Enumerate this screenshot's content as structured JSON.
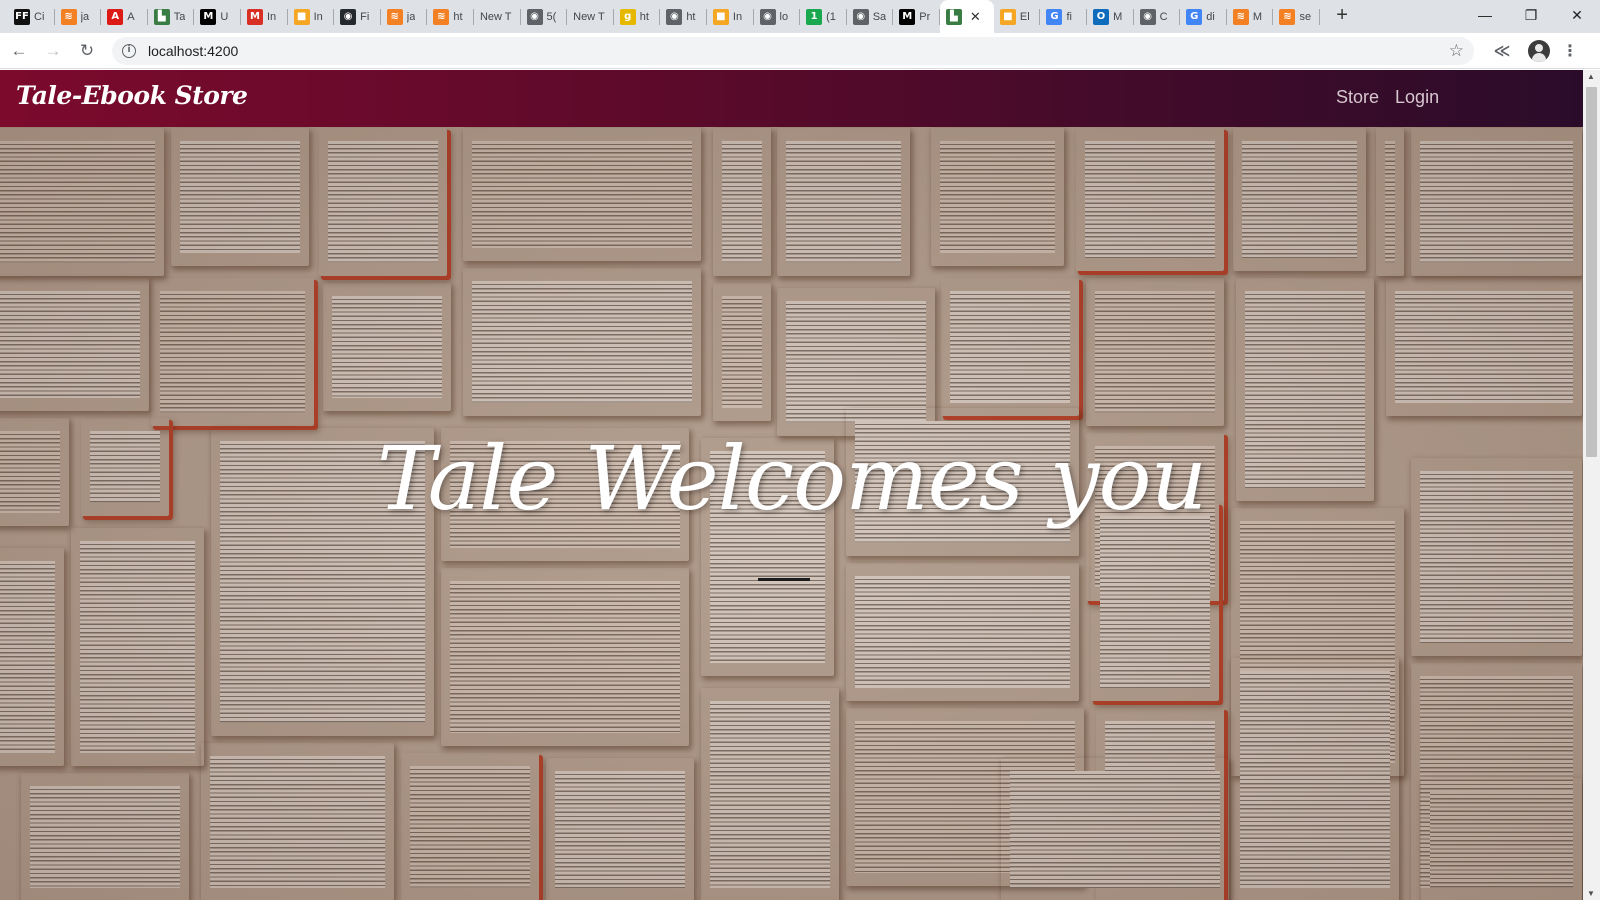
{
  "browser": {
    "tabs": [
      {
        "favicon": "FF",
        "color": "#111111",
        "title": "Ci"
      },
      {
        "favicon": "≋",
        "color": "#f48024",
        "title": "ja"
      },
      {
        "favicon": "A",
        "color": "#dd1b16",
        "title": "A"
      },
      {
        "favicon": "▙",
        "color": "#3a7d44",
        "title": "Ta"
      },
      {
        "favicon": "M",
        "color": "#000000",
        "title": "U"
      },
      {
        "favicon": "M",
        "color": "#d93025",
        "title": "In"
      },
      {
        "favicon": "■",
        "color": "#f5a623",
        "title": "In"
      },
      {
        "favicon": "◉",
        "color": "#24292e",
        "title": "Fi"
      },
      {
        "favicon": "≋",
        "color": "#f48024",
        "title": "ja"
      },
      {
        "favicon": "≋",
        "color": "#f48024",
        "title": "ht"
      },
      {
        "favicon": "",
        "color": "",
        "title": "New T"
      },
      {
        "favicon": "◉",
        "color": "#5f6368",
        "title": "5("
      },
      {
        "favicon": "",
        "color": "",
        "title": "New T"
      },
      {
        "favicon": "g",
        "color": "#e6b800",
        "title": "ht"
      },
      {
        "favicon": "◉",
        "color": "#5f6368",
        "title": "ht"
      },
      {
        "favicon": "■",
        "color": "#f5a623",
        "title": "In"
      },
      {
        "favicon": "◉",
        "color": "#5f6368",
        "title": "lo"
      },
      {
        "favicon": "1",
        "color": "#1aa84f",
        "title": "(1"
      },
      {
        "favicon": "◉",
        "color": "#5f6368",
        "title": "Sa"
      },
      {
        "favicon": "M",
        "color": "#000000",
        "title": "Pr"
      },
      {
        "favicon": "▙",
        "color": "#3a7d44",
        "title": "",
        "active": true
      },
      {
        "favicon": "■",
        "color": "#f5a623",
        "title": "El"
      },
      {
        "favicon": "G",
        "color": "#4285f4",
        "title": "fi"
      },
      {
        "favicon": "O",
        "color": "#0f6cbd",
        "title": "M"
      },
      {
        "favicon": "◉",
        "color": "#5f6368",
        "title": "C"
      },
      {
        "favicon": "G",
        "color": "#4285f4",
        "title": "di"
      },
      {
        "favicon": "≋",
        "color": "#f48024",
        "title": "M"
      },
      {
        "favicon": "≋",
        "color": "#f48024",
        "title": "se"
      }
    ],
    "new_tab": "+",
    "window_controls": {
      "minimize": "—",
      "restore": "❐",
      "close": "✕"
    },
    "nav": {
      "back": "←",
      "forward": "→",
      "reload": "↻"
    },
    "url": "localhost:4200",
    "info_glyph": "i",
    "star": "☆",
    "extension": "≪",
    "menu": "⋮"
  },
  "site": {
    "brand": "Tale-Ebook Store",
    "nav_links": [
      "Store",
      "Login"
    ],
    "hero_title": "Tale Welcomes you",
    "colors": {
      "navbar_start": "#7c0a2d",
      "navbar_end": "#2a0c2a",
      "hero_text": "#ffffff",
      "divider": "#1c1c1c"
    }
  }
}
